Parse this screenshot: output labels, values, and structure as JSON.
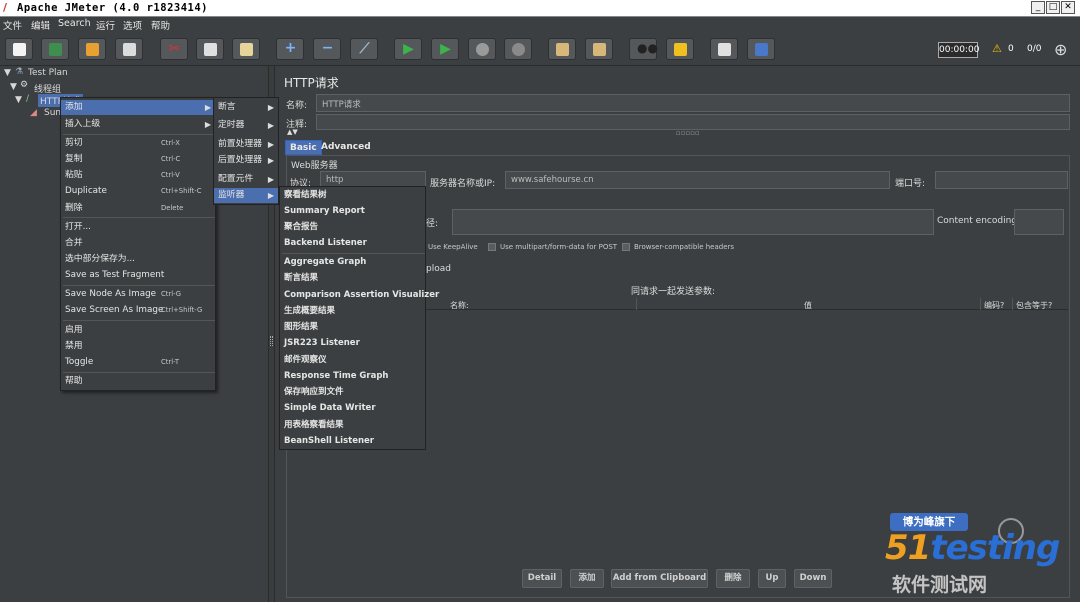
{
  "window": {
    "title": "Apache JMeter (4.0 r1823414)",
    "controls": [
      "_",
      "□",
      "✕"
    ]
  },
  "menubar": [
    "文件",
    "编辑",
    "Search",
    "运行",
    "选项",
    "帮助"
  ],
  "toolbar": {
    "buttons": [
      "new-icon",
      "templates-icon",
      "open-icon",
      "save-icon",
      "cut-icon",
      "copy-icon",
      "paste-icon",
      "expand-icon",
      "collapse-icon",
      "toggle-icon",
      "start-icon",
      "start-no-pauses-icon",
      "stop-icon",
      "shutdown-icon",
      "clear-icon",
      "clear-all-icon",
      "search-icon",
      "reset-search-icon",
      "function-helper-icon",
      "help-icon"
    ],
    "timer": "00:00:00",
    "warning_count": "0",
    "thread_ratio": "0/0"
  },
  "tree": {
    "test_plan": "Test Plan",
    "thread_group": "线程组",
    "http_request": "HTTP请求",
    "summary": "Sum"
  },
  "context_menu": {
    "items": [
      {
        "label": "添加",
        "shortcut": "",
        "submenu": true
      },
      {
        "label": "插入上级",
        "shortcut": "",
        "submenu": true
      },
      {
        "label": "剪切",
        "shortcut": "Ctrl-X"
      },
      {
        "label": "复制",
        "shortcut": "Ctrl-C"
      },
      {
        "label": "粘贴",
        "shortcut": "Ctrl-V"
      },
      {
        "label": "Duplicate",
        "shortcut": "Ctrl+Shift-C"
      },
      {
        "label": "删除",
        "shortcut": "Delete"
      },
      {
        "label": "打开...",
        "shortcut": ""
      },
      {
        "label": "合并",
        "shortcut": ""
      },
      {
        "label": "选中部分保存为...",
        "shortcut": ""
      },
      {
        "label": "Save as Test Fragment",
        "shortcut": ""
      },
      {
        "label": "Save Node As Image",
        "shortcut": "Ctrl-G"
      },
      {
        "label": "Save Screen As Image",
        "shortcut": "Ctrl+Shift-G"
      },
      {
        "label": "启用",
        "shortcut": ""
      },
      {
        "label": "禁用",
        "shortcut": ""
      },
      {
        "label": "Toggle",
        "shortcut": "Ctrl-T"
      },
      {
        "label": "帮助",
        "shortcut": ""
      }
    ]
  },
  "submenu_add": [
    "断言",
    "定时器",
    "前置处理器",
    "后置处理器",
    "配置元件",
    "监听器"
  ],
  "submenu_listeners": [
    "察看结果树",
    "Summary Report",
    "聚合报告",
    "Backend Listener",
    "Aggregate Graph",
    "断言结果",
    "Comparison Assertion Visualizer",
    "生成概要结果",
    "图形结果",
    "JSR223 Listener",
    "邮件观察仪",
    "Response Time Graph",
    "保存响应到文件",
    "Simple Data Writer",
    "用表格察看结果",
    "BeanShell Listener"
  ],
  "panel": {
    "title": "HTTP请求",
    "name_label": "名称:",
    "name_value": "HTTP请求",
    "comment_label": "注释:",
    "tabs": [
      "Basic",
      "Advanced"
    ],
    "web_server": "Web服务器",
    "protocol_label": "协议:",
    "protocol_value": "http",
    "server_label": "服务器名称或IP:",
    "server_value": "www.safehourse.cn",
    "port_label": "端口号:",
    "path_label": "径:",
    "encoding_label": "Content encoding:",
    "keepalive": "Use KeepAlive",
    "multipart": "Use multipart/form-data for POST",
    "browser_headers": "Browser-compatible headers",
    "upload_tab": "pload",
    "params_title": "同请求一起发送参数:",
    "col_name": "名称:",
    "col_value": "值",
    "col_encode": "编码?",
    "col_include": "包含等于?",
    "buttons": [
      "Detail",
      "添加",
      "Add from Clipboard",
      "删除",
      "Up",
      "Down"
    ]
  },
  "watermark": {
    "badge": "博为峰旗下",
    "brand_a": "51",
    "brand_b": "testing",
    "site": "软件测试网"
  }
}
